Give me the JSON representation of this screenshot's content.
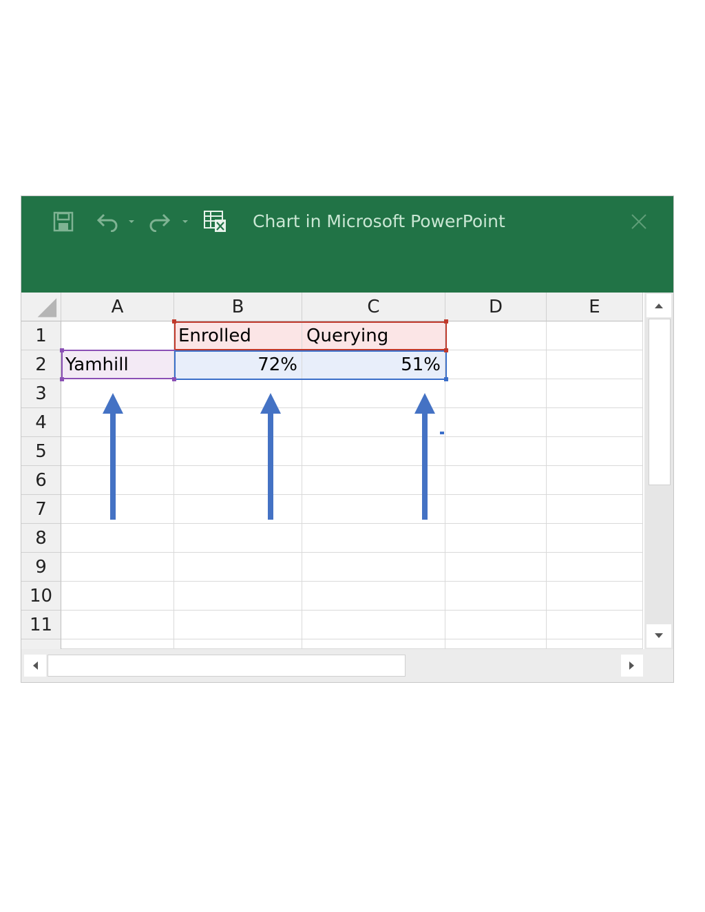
{
  "window": {
    "title": "Chart in Microsoft PowerPoint",
    "accent_color": "#217346"
  },
  "toolbar": {
    "icons": [
      "save-icon",
      "undo-icon",
      "undo-dropdown-icon",
      "redo-icon",
      "redo-dropdown-icon",
      "edit-data-icon",
      "close-icon"
    ]
  },
  "columns": [
    "A",
    "B",
    "C",
    "D",
    "E"
  ],
  "rows": [
    "1",
    "2",
    "3",
    "4",
    "5",
    "6",
    "7",
    "8",
    "9",
    "10",
    "11"
  ],
  "cells": {
    "B1": "Enrolled",
    "C1": "Querying",
    "A2": "Yamhill",
    "B2": "72%",
    "C2": "51%"
  },
  "highlights": {
    "series_color": "#c0392b",
    "category_color": "#8a4fb5",
    "values_color": "#3a6ec9"
  },
  "annotations": {
    "arrow_color": "#4472c4"
  }
}
